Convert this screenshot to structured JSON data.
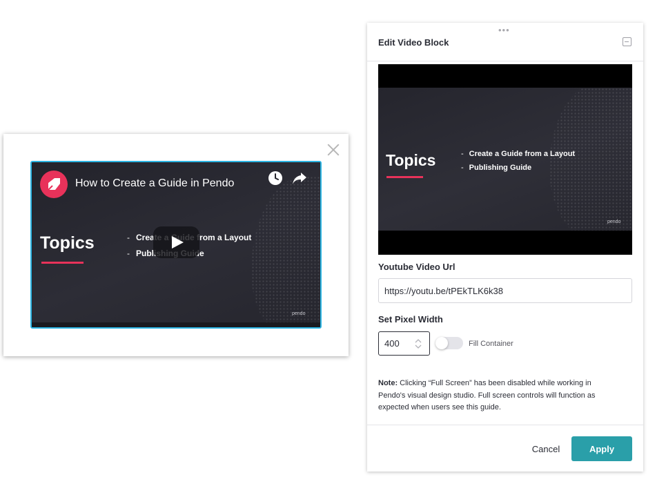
{
  "guide_preview": {
    "video": {
      "title": "How to Create a Guide in Pendo",
      "slide_heading": "Topics",
      "topics": [
        "Create a Guide from a Layout",
        "Publishing Guide"
      ],
      "watermark": "pendo",
      "icons": [
        "pendo-logo-icon",
        "watch-later-icon",
        "share-icon",
        "play-icon"
      ]
    },
    "close_icon": "close-icon"
  },
  "panel": {
    "title": "Edit Video Block",
    "preview": {
      "slide_heading": "Topics",
      "topics": [
        "Create a Guide from a Layout",
        "Publishing Guide"
      ],
      "watermark": "pendo"
    },
    "url_label": "Youtube Video Url",
    "url_value": "https://youtu.be/tPEkTLK6k38",
    "width_label": "Set Pixel Width",
    "width_value": "400",
    "fill_container_label": "Fill Container",
    "fill_container_on": false,
    "note_bold": "Note:",
    "note_text": " Clicking “Full Screen” has been disabled while working in Pendo's visual design studio. Full screen controls will function as expected when users see this guide.",
    "cancel_label": "Cancel",
    "apply_label": "Apply"
  },
  "colors": {
    "accent": "#2a9fa9",
    "pendo_pink": "#e8325a",
    "selection_border": "#2cb5e3"
  }
}
